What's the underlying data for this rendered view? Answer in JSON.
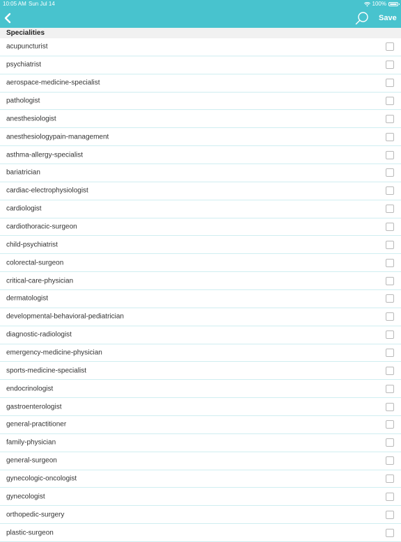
{
  "status_bar": {
    "time": "10:05 AM",
    "date": "Sun Jul 14",
    "battery": "100%",
    "wifi_icon": "wifi-icon",
    "battery_icon": "battery-full-icon"
  },
  "nav_bar": {
    "back_icon": "chevron-left-icon",
    "search_icon": "search-icon",
    "save_label": "Save",
    "accent_color": "#48c3ce"
  },
  "section": {
    "title": "Specialities"
  },
  "specialities": [
    {
      "label": "acupuncturist",
      "checked": false
    },
    {
      "label": "psychiatrist",
      "checked": false
    },
    {
      "label": "aerospace-medicine-specialist",
      "checked": false
    },
    {
      "label": "pathologist",
      "checked": false
    },
    {
      "label": "anesthesiologist",
      "checked": false
    },
    {
      "label": "anesthesiologypain-management",
      "checked": false
    },
    {
      "label": "asthma-allergy-specialist",
      "checked": false
    },
    {
      "label": "bariatrician",
      "checked": false
    },
    {
      "label": "cardiac-electrophysiologist",
      "checked": false
    },
    {
      "label": "cardiologist",
      "checked": false
    },
    {
      "label": "cardiothoracic-surgeon",
      "checked": false
    },
    {
      "label": "child-psychiatrist",
      "checked": false
    },
    {
      "label": "colorectal-surgeon",
      "checked": false
    },
    {
      "label": "critical-care-physician",
      "checked": false
    },
    {
      "label": "dermatologist",
      "checked": false
    },
    {
      "label": "developmental-behavioral-pediatrician",
      "checked": false
    },
    {
      "label": "diagnostic-radiologist",
      "checked": false
    },
    {
      "label": "emergency-medicine-physician",
      "checked": false
    },
    {
      "label": "sports-medicine-specialist",
      "checked": false
    },
    {
      "label": "endocrinologist",
      "checked": false
    },
    {
      "label": "gastroenterologist",
      "checked": false
    },
    {
      "label": "general-practitioner",
      "checked": false
    },
    {
      "label": "family-physician",
      "checked": false
    },
    {
      "label": "general-surgeon",
      "checked": false
    },
    {
      "label": "gynecologic-oncologist",
      "checked": false
    },
    {
      "label": "gynecologist",
      "checked": false
    },
    {
      "label": "orthopedic-surgery",
      "checked": false
    },
    {
      "label": "plastic-surgeon",
      "checked": false
    }
  ]
}
